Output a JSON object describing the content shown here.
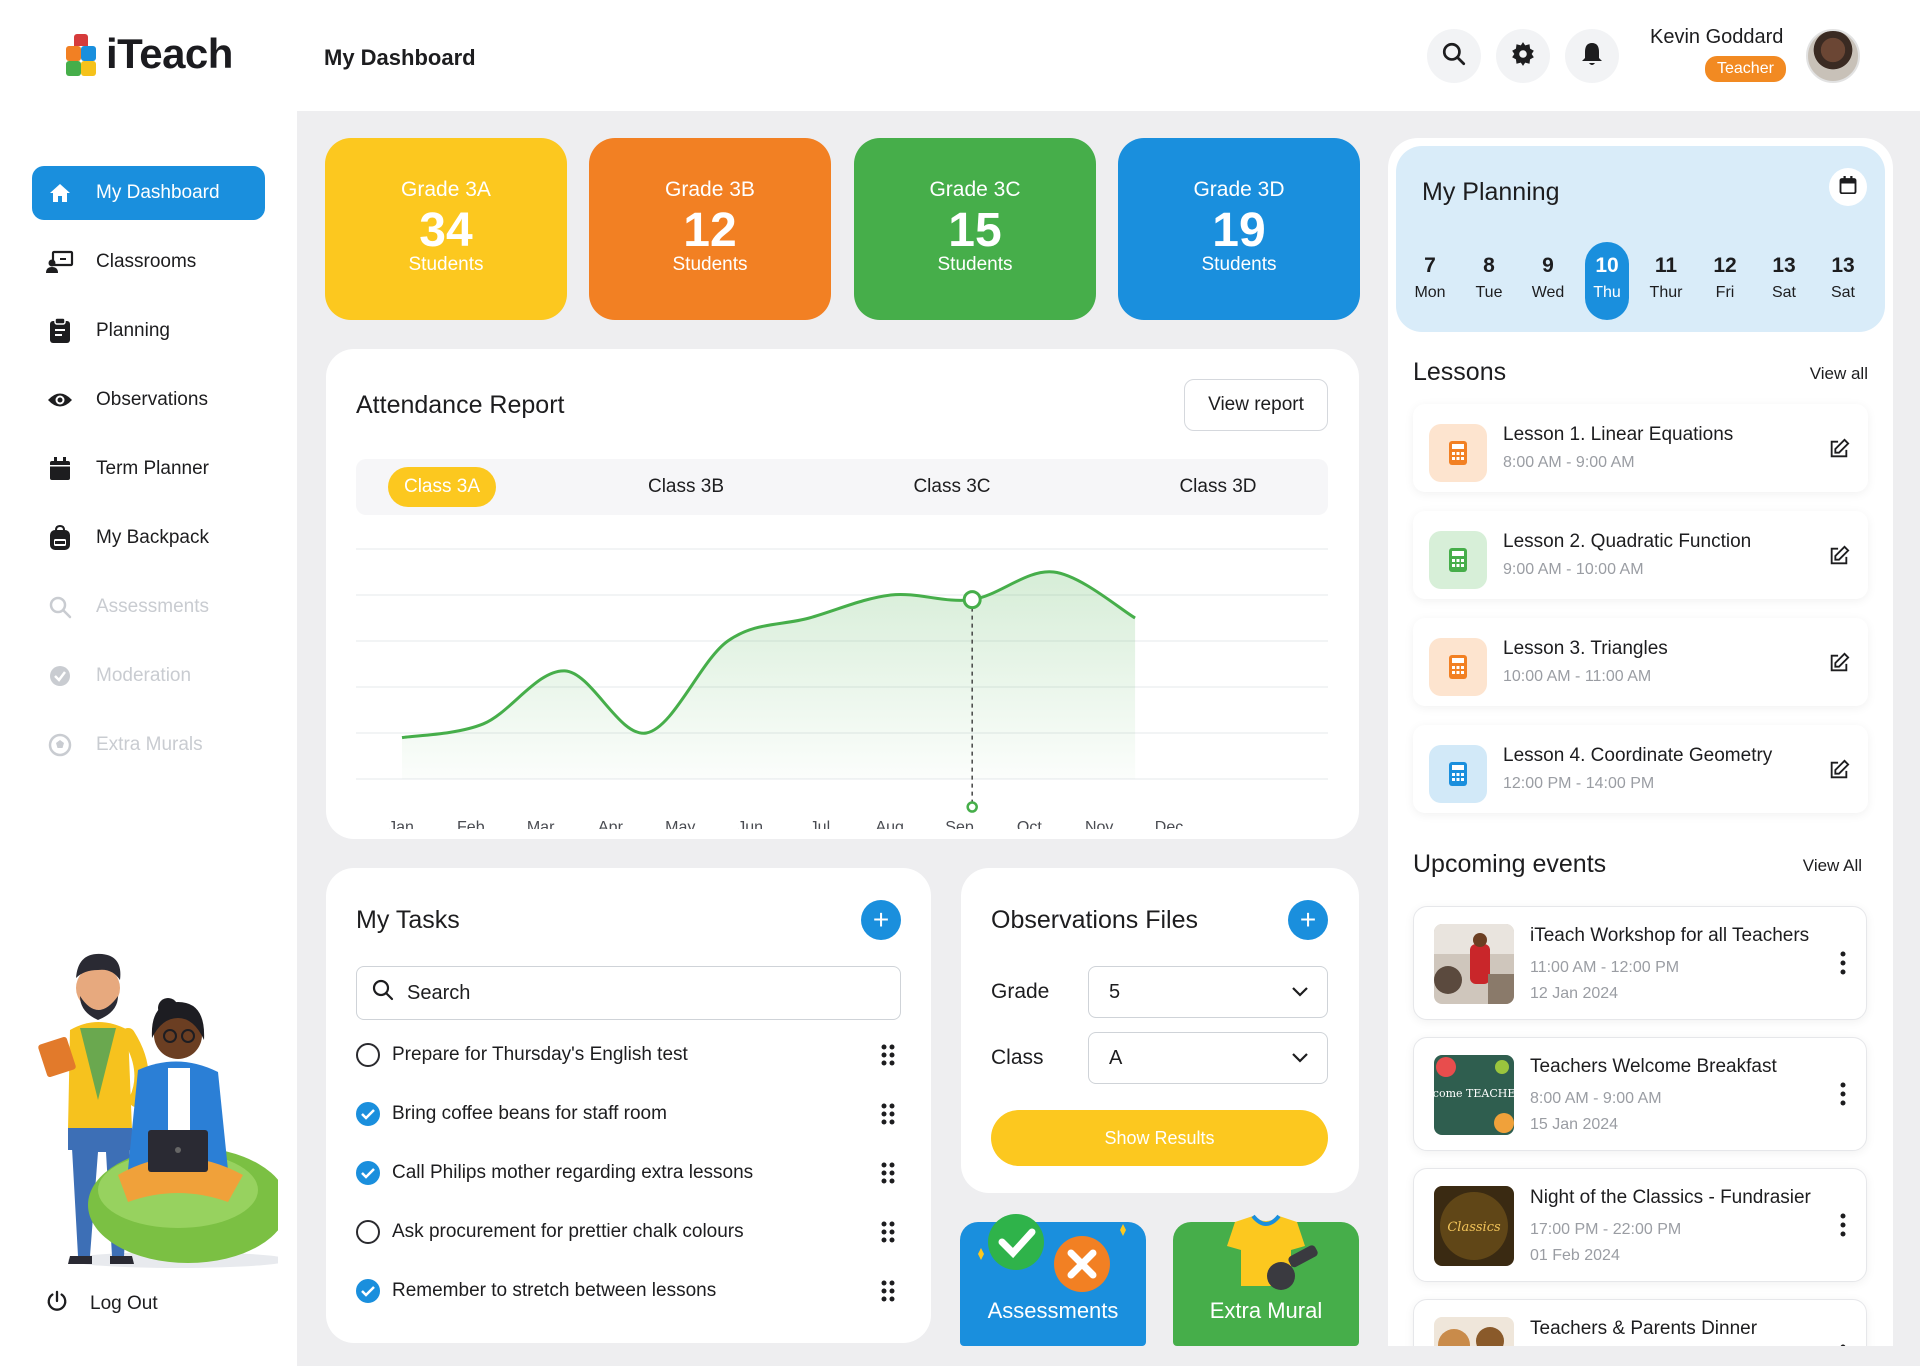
{
  "app": {
    "name": "iTeach"
  },
  "sidebar": {
    "items": [
      {
        "label": "My Dashboard",
        "icon": "home-icon"
      },
      {
        "label": "Classrooms",
        "icon": "classroom-icon"
      },
      {
        "label": "Planning",
        "icon": "clipboard-icon"
      },
      {
        "label": "Observations",
        "icon": "eye-icon"
      },
      {
        "label": "Term Planner",
        "icon": "calendar-icon"
      },
      {
        "label": "My Backpack",
        "icon": "backpack-icon"
      },
      {
        "label": "Assessments",
        "icon": "search-icon"
      },
      {
        "label": "Moderation",
        "icon": "check-badge-icon"
      },
      {
        "label": "Extra Murals",
        "icon": "soccer-ball-icon"
      }
    ],
    "logout_label": "Log Out"
  },
  "header": {
    "title": "My Dashboard",
    "user_name": "Kevin Goddard",
    "user_role": "Teacher"
  },
  "grades": [
    {
      "title": "Grade 3A",
      "count": "34",
      "label": "Students",
      "color": "#fcc81f"
    },
    {
      "title": "Grade 3B",
      "count": "12",
      "label": "Students",
      "color": "#f28023"
    },
    {
      "title": "Grade 3C",
      "count": "15",
      "label": "Students",
      "color": "#46ae4a"
    },
    {
      "title": "Grade 3D",
      "count": "19",
      "label": "Students",
      "color": "#1a8fdd"
    }
  ],
  "attendance": {
    "title": "Attendance Report",
    "view_report": "View report",
    "tabs": [
      "Class 3A",
      "Class 3B",
      "Class 3C",
      "Class 3D"
    ],
    "active_tab": "Class 3A"
  },
  "chart_data": {
    "type": "area",
    "categories": [
      "Jan",
      "Feb",
      "Mar",
      "Apr",
      "May",
      "Jun",
      "Jul",
      "Aug",
      "Sep",
      "Oct",
      "Nov",
      "Dec"
    ],
    "values": [
      18,
      24,
      47,
      20,
      60,
      70,
      80,
      78,
      90,
      70,
      null,
      null
    ],
    "highlight": "Aug",
    "ylim": [
      0,
      100
    ],
    "grid": true,
    "color": "#46ae4a"
  },
  "tasks": {
    "title": "My Tasks",
    "search_placeholder": "Search",
    "items": [
      {
        "text": "Prepare for Thursday's English test",
        "done": false
      },
      {
        "text": "Bring coffee beans for staff room",
        "done": true
      },
      {
        "text": "Call Philips mother regarding extra lessons",
        "done": true
      },
      {
        "text": "Ask procurement for prettier chalk colours",
        "done": false
      },
      {
        "text": "Remember to stretch between lessons",
        "done": true
      }
    ]
  },
  "observations": {
    "title": "Observations Files",
    "grade_label": "Grade",
    "grade_value": "5",
    "class_label": "Class",
    "class_value": "A",
    "button": "Show Results"
  },
  "quick_tiles": [
    {
      "label": "Assessments",
      "color": "#1a8fdd"
    },
    {
      "label": "Extra Mural",
      "color": "#46ae4a"
    }
  ],
  "planning": {
    "title": "My Planning",
    "days": [
      {
        "num": "7",
        "name": "Mon"
      },
      {
        "num": "8",
        "name": "Tue"
      },
      {
        "num": "9",
        "name": "Wed"
      },
      {
        "num": "10",
        "name": "Thu"
      },
      {
        "num": "11",
        "name": "Thur"
      },
      {
        "num": "12",
        "name": "Fri"
      },
      {
        "num": "13",
        "name": "Sat"
      },
      {
        "num": "13",
        "name": "Sat"
      }
    ],
    "active_day": "10"
  },
  "lessons": {
    "title": "Lessons",
    "view_all": "View all",
    "items": [
      {
        "title": "Lesson 1. Linear Equations",
        "time": "8:00 AM - 9:00 AM",
        "color": "#f28023"
      },
      {
        "title": "Lesson 2. Quadratic Function",
        "time": "9:00 AM - 10:00 AM",
        "color": "#46ae4a"
      },
      {
        "title": "Lesson 3. Triangles",
        "time": "10:00 AM - 11:00 AM",
        "color": "#f28023"
      },
      {
        "title": "Lesson 4. Coordinate Geometry",
        "time": "12:00 PM - 14:00 PM",
        "color": "#1a8fdd"
      }
    ]
  },
  "events": {
    "title": "Upcoming events",
    "view_all": "View All",
    "items": [
      {
        "title": "iTeach Workshop for all Teachers",
        "time": "11:00 AM - 12:00 PM",
        "date": "12 Jan 2024"
      },
      {
        "title": "Teachers Welcome  Breakfast",
        "time": "8:00 AM - 9:00 AM",
        "date": "15 Jan 2024",
        "thumb_text": "Welcome TEACHERS!"
      },
      {
        "title": "Night of the Classics - Fundrasier",
        "time": "17:00 PM - 22:00 PM",
        "date": "01 Feb 2024",
        "thumb_text": "Classics"
      },
      {
        "title": "Teachers & Parents Dinner",
        "time": "",
        "date": ""
      }
    ]
  }
}
